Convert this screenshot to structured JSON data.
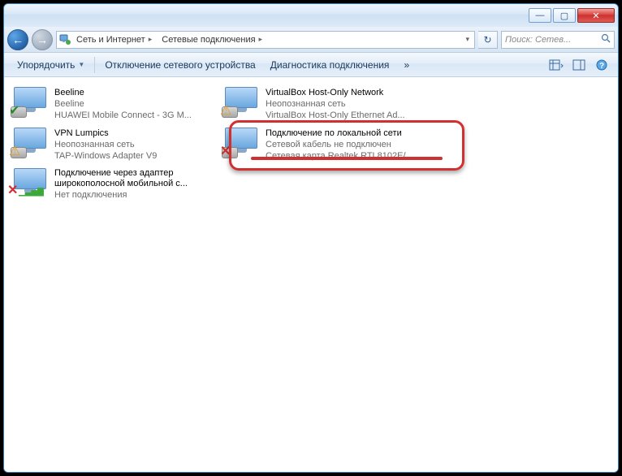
{
  "breadcrumbs": [
    "Сеть и Интернет",
    "Сетевые подключения"
  ],
  "search_placeholder": "Поиск: Сетев...",
  "toolbar": {
    "organize": "Упорядочить",
    "disable": "Отключение сетевого устройства",
    "diagnose": "Диагностика подключения",
    "more": "»"
  },
  "connections": [
    {
      "name": "Beeline",
      "line2": "Beeline",
      "line3": "HUAWEI Mobile Connect - 3G M...",
      "overlay": "check"
    },
    {
      "name": "VPN Lumpics",
      "line2": "Неопознанная сеть",
      "line3": "TAP-Windows Adapter V9",
      "overlay": "warn"
    },
    {
      "name": "Подключение через адаптер широкополосной мобильной с...",
      "line2": "Нет подключения",
      "line3": "",
      "overlay": "xbars"
    },
    {
      "name": "VirtualBox Host-Only Network",
      "line2": "Неопознанная сеть",
      "line3": "VirtualBox Host-Only Ethernet Ad...",
      "overlay": "warn"
    },
    {
      "name": "Подключение по локальной сети",
      "line2": "Сетевой кабель не подключен",
      "line3": "Сетевая карта Realtek RTL8102E/...",
      "overlay": "x",
      "highlighted": true
    }
  ]
}
